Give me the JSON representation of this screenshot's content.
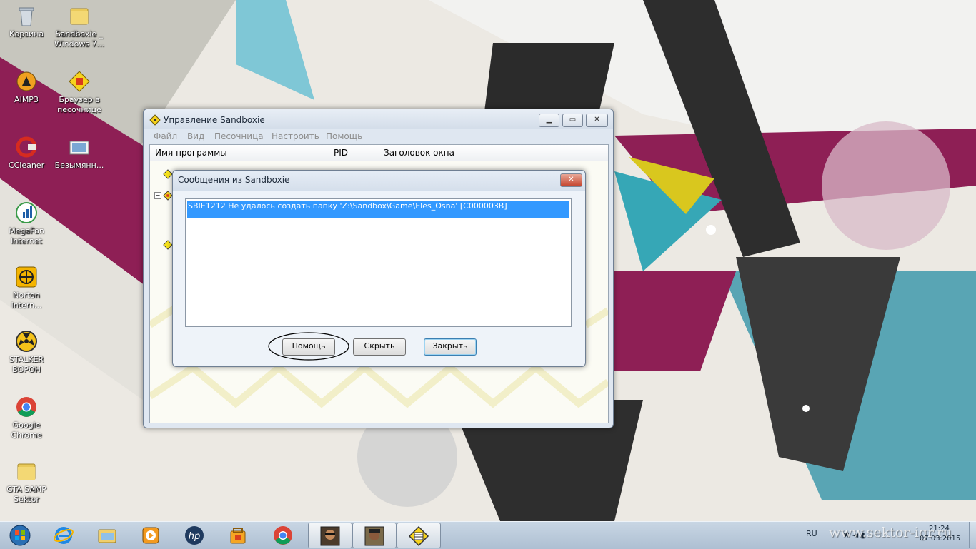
{
  "desktop": {
    "icons": [
      {
        "label": "Корзина",
        "icon": "recycle-bin-icon"
      },
      {
        "label": "Sandboxie _ Windows 7...",
        "icon": "folder-icon"
      },
      {
        "label": "AIMP3",
        "icon": "aimp-icon"
      },
      {
        "label": "Браузер в песочнице",
        "icon": "sandboxed-browser-icon"
      },
      {
        "label": "CCleaner",
        "icon": "ccleaner-icon"
      },
      {
        "label": "Безымянн...",
        "icon": "image-file-icon"
      },
      {
        "label": "MegaFon Internet",
        "icon": "megafon-icon"
      },
      {
        "label": "Norton Intern...",
        "icon": "norton-icon"
      },
      {
        "label": "STALKER ВОРОН",
        "icon": "stalker-icon"
      },
      {
        "label": "Google Chrome",
        "icon": "chrome-icon"
      },
      {
        "label": "GTA SAMP Sektor",
        "icon": "folder-icon"
      }
    ]
  },
  "main_window": {
    "title": "Управление Sandboxie",
    "menu": [
      "Файл",
      "Вид",
      "Песочница",
      "Настроить",
      "Помощь"
    ],
    "columns": [
      "Имя программы",
      "PID",
      "Заголовок окна"
    ]
  },
  "dialog": {
    "title": "Сообщения из Sandboxie",
    "message": "SBIE1212 Не удалось создать папку 'Z:\\Sandbox\\Game\\Eles_Osna' [C000003B]",
    "buttons": {
      "help": "Помощь",
      "hide": "Скрыть",
      "close": "Закрыть"
    }
  },
  "taskbar": {
    "pinned": [
      "start-orb-icon",
      "internet-explorer-icon",
      "explorer-icon",
      "media-player-icon",
      "hp-icon",
      "store-icon",
      "chrome-icon",
      "gta-icon",
      "gta-icon",
      "sandboxie-icon"
    ],
    "language": "RU",
    "time": "21:24",
    "date": "07.03.2015"
  },
  "watermark": {
    "text": "www.sektor-igr.ru"
  },
  "colors": {
    "selection": "#3399ff",
    "accent_magenta": "#8c1e52",
    "accent_teal": "#3fa8b8"
  }
}
